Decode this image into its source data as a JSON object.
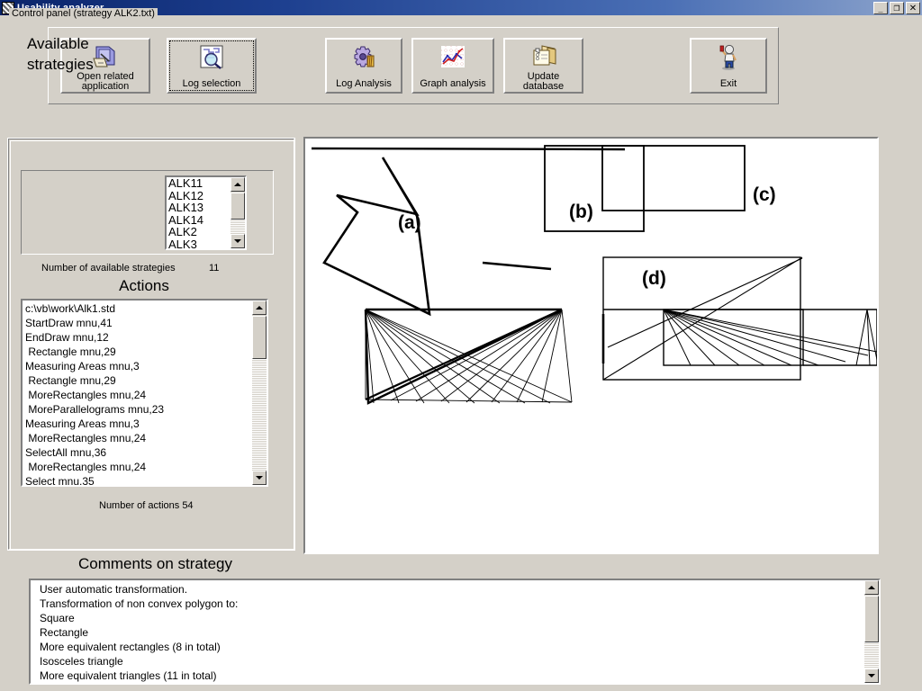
{
  "window": {
    "title": "Usability analyzer",
    "icon": "app-hatch-icon",
    "controls": {
      "minimize": "_",
      "restore": "❐",
      "close": "✕"
    }
  },
  "toolbar": {
    "buttons": [
      {
        "label": "Open related\napplication",
        "icon": "open-folder-icon",
        "focused": false
      },
      {
        "label": "Log selection",
        "icon": "magnifier-log-icon",
        "focused": true
      },
      {
        "label": "Log Analysis",
        "icon": "gear-analysis-icon",
        "focused": false
      },
      {
        "label": "Graph analysis",
        "icon": "line-chart-icon",
        "focused": false
      },
      {
        "label": "Update\ndatabase",
        "icon": "database-folder-icon",
        "focused": false
      },
      {
        "label": "Exit",
        "icon": "person-wave-icon",
        "focused": false
      }
    ]
  },
  "control_panel": {
    "legend": "Control panel (strategy ALK2.txt)",
    "available_strategies_label": "Available\nstrategies",
    "strategies": [
      "ALK11",
      "ALK12",
      "ALK13",
      "ALK14",
      "ALK2",
      "ALK3"
    ],
    "num_strategies_label": "Number of available strategies",
    "num_strategies_value": "11",
    "actions_title": "Actions",
    "actions": [
      "c:\\vb\\work\\Alk1.std",
      "StartDraw mnu,41",
      "EndDraw mnu,12",
      " Rectangle mnu,29",
      "Measuring Areas mnu,3",
      " Rectangle mnu,29",
      " MoreRectangles mnu,24",
      " MoreParallelograms mnu,23",
      "Measuring Areas mnu,3",
      " MoreRectangles mnu,24",
      "SelectAll mnu,36",
      " MoreRectangles mnu,24",
      "Select mnu,35"
    ],
    "num_actions": "Number of actions 54"
  },
  "comments": {
    "title": "Comments on strategy",
    "lines": [
      "User automatic transformation.",
      "Transformation of non convex polygon to:",
      "Square",
      "Rectangle",
      "More equivalent rectangles (8 in total)",
      "Isosceles triangle",
      "More equivalent triangles (11 in total)"
    ]
  },
  "canvas": {
    "figure_labels": [
      "(a)",
      "(b)",
      "(c)",
      "(d)"
    ],
    "description": "Geometry construction drawing: non-convex polygon, equivalent rectangles, and fans of equivalent triangles",
    "stroke_color": "#000000",
    "background_color": "#ffffff"
  }
}
